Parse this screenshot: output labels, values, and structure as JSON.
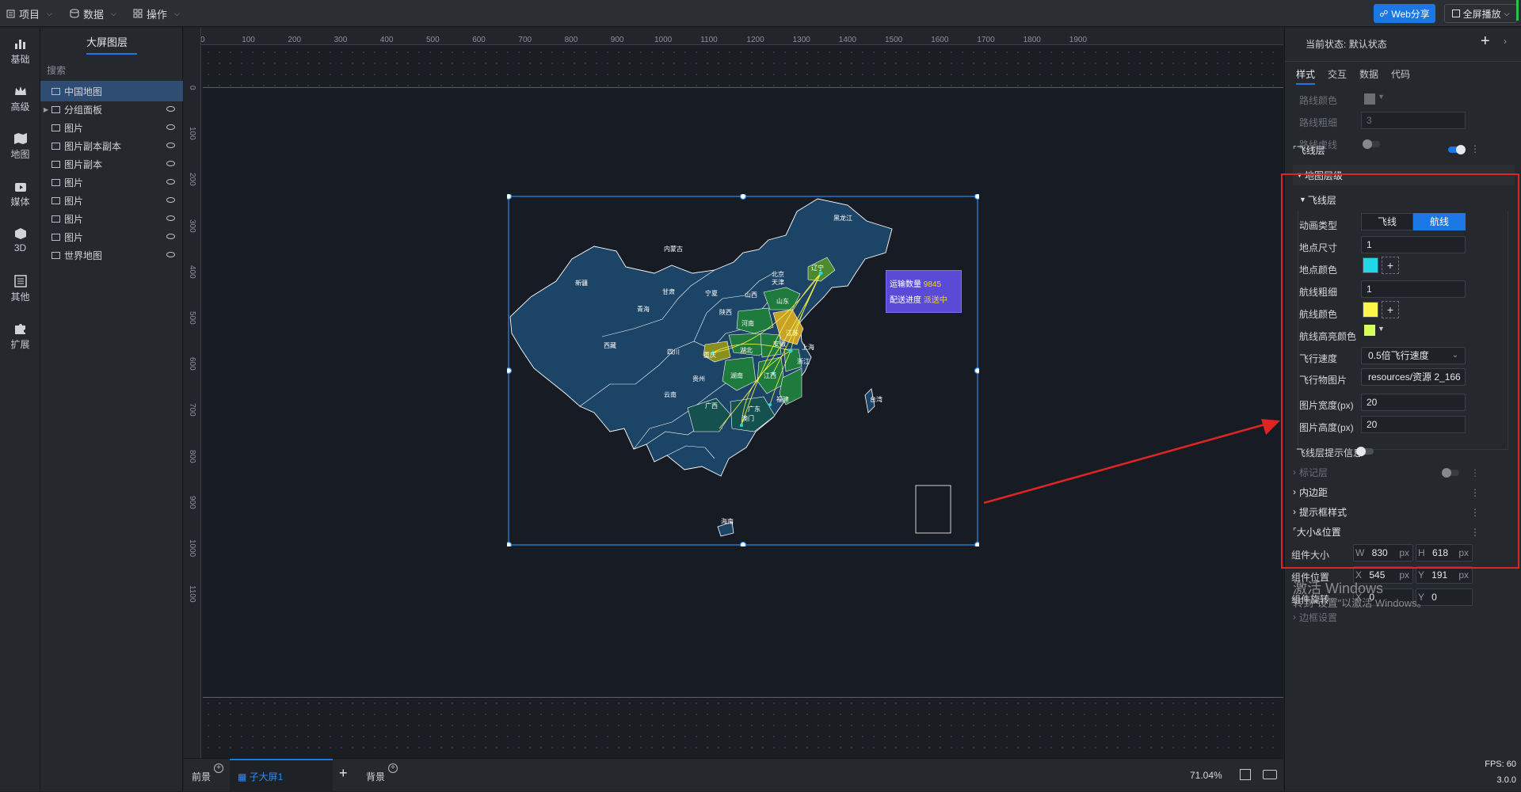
{
  "topbar": {
    "project": "项目",
    "data": "数据",
    "operate": "操作",
    "share": "Web分享",
    "fullscreen": "全屏播放"
  },
  "leftbar": [
    "基础",
    "高级",
    "地图",
    "媒体",
    "3D",
    "其他",
    "扩展"
  ],
  "layers": {
    "title": "大屏图层",
    "search_placeholder": "搜索",
    "items": [
      {
        "label": "中国地图",
        "active": true
      },
      {
        "label": "分组面板"
      },
      {
        "label": "图片"
      },
      {
        "label": "图片副本副本"
      },
      {
        "label": "图片副本"
      },
      {
        "label": "图片"
      },
      {
        "label": "图片"
      },
      {
        "label": "图片"
      },
      {
        "label": "图片"
      },
      {
        "label": "世界地图"
      }
    ]
  },
  "ruler": {
    "h": [
      "0",
      "100",
      "200",
      "300",
      "400",
      "500",
      "600",
      "700",
      "800",
      "900",
      "1000",
      "1100",
      "1200",
      "1300",
      "1400",
      "1500",
      "1600",
      "1700",
      "1800",
      "1900"
    ],
    "v": [
      "0",
      "100",
      "200",
      "300",
      "400",
      "500",
      "600",
      "700",
      "800",
      "900",
      "1000",
      "1100"
    ]
  },
  "map": {
    "provinces": [
      "黑龙江",
      "内蒙古",
      "新疆",
      "辽宁",
      "北京",
      "天津",
      "甘肃",
      "宁夏",
      "山西",
      "山东",
      "青海",
      "陕西",
      "河南",
      "江苏",
      "安徽",
      "上海",
      "西藏",
      "四川",
      "湖北",
      "重庆",
      "浙江",
      "贵州",
      "湖南",
      "江西",
      "福建",
      "云南",
      "广西",
      "广东",
      "澳门",
      "台湾",
      "海南"
    ],
    "tooltip": {
      "count_label": "运输数量",
      "count_value": "9845",
      "status_label": "配送进度",
      "status_value": "派送中"
    }
  },
  "bottombar": {
    "front": "前景",
    "sub_screen": "子大屏1",
    "background": "背景",
    "zoom": "71.04%"
  },
  "right": {
    "status_label": "当前状态:",
    "status_value": "默认状态",
    "tabs": [
      "样式",
      "交互",
      "数据",
      "代码"
    ],
    "route_color_label": "路线颜色",
    "route_width_label": "路线粗细",
    "route_width_value": "3",
    "route_dash_label": "路线虚线",
    "flyline_section": "飞线层",
    "map_level": "地图层级",
    "flyline_sub": "飞线层",
    "anim_type_label": "动画类型",
    "anim_opt1": "飞线",
    "anim_opt2": "航线",
    "point_size_label": "地点尺寸",
    "point_size_value": "1",
    "point_color_label": "地点颜色",
    "route_thick_label": "航线粗细",
    "route_thick_value": "1",
    "route_col_label": "航线颜色",
    "highlight_label": "航线高亮颜色",
    "speed_label": "飞行速度",
    "speed_value": "0.5倍飞行速度",
    "image_label": "飞行物图片",
    "image_value": "resources/资源 2_166",
    "img_w_label": "图片宽度(px)",
    "img_w_value": "20",
    "img_h_label": "图片高度(px)",
    "img_h_value": "20",
    "tip_label": "飞线层提示信息",
    "marker_layer": "标记层",
    "padding": "内边距",
    "tip_style": "提示框样式",
    "size_pos": "大小&位置",
    "comp_size": "组件大小",
    "w_label": "W",
    "w_value": "830",
    "h_label": "H",
    "h_value": "618",
    "px": "px",
    "comp_pos": "组件位置",
    "x_label": "X",
    "x_value": "545",
    "y_label": "Y",
    "y_value": "191",
    "comp_rot": "组件旋转",
    "rot_x": "0",
    "rot_y": "0",
    "border": "边框设置",
    "fps": "FPS: 60",
    "version": "3.0.0",
    "watermark1": "激活 Windows",
    "watermark2": "转到\"设置\"以激活 Windows。"
  },
  "colors": {
    "accent": "#1b77e4",
    "map_base": "#1c4466",
    "map_green": "#1f7a3d",
    "map_yellow": "#c9a227",
    "map_olive": "#8a8f1e",
    "map_teal": "#15524f",
    "flyline": "#fff64a",
    "point": "#1fd9e6",
    "highlight": "#d4ff5c"
  }
}
